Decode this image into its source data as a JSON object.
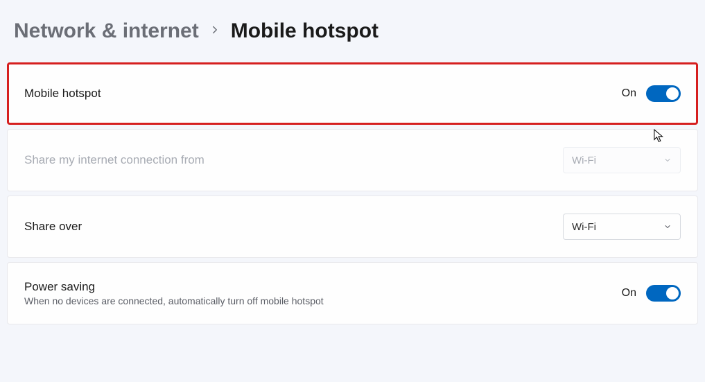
{
  "breadcrumb": {
    "root": "Network & internet",
    "current": "Mobile hotspot"
  },
  "hotspot": {
    "title": "Mobile hotspot",
    "state": "On"
  },
  "share_from": {
    "title": "Share my internet connection from",
    "value": "Wi-Fi"
  },
  "share_over": {
    "title": "Share over",
    "value": "Wi-Fi"
  },
  "power_saving": {
    "title": "Power saving",
    "sub": "When no devices are connected, automatically turn off mobile hotspot",
    "state": "On"
  }
}
